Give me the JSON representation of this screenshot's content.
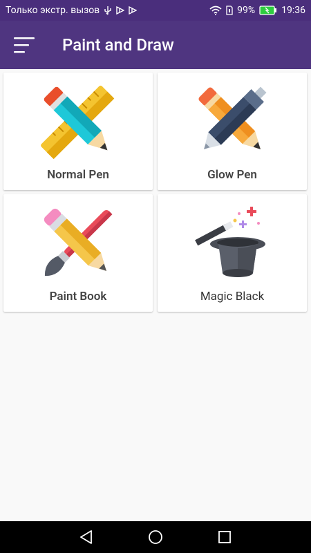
{
  "status_bar": {
    "carrier_text": "Только экстр. вызов",
    "battery_percent": "99%",
    "time": "19:36",
    "icons": [
      "usb-icon",
      "notification-icon",
      "notification-icon",
      "wifi-icon",
      "sim-icon",
      "battery-icon"
    ]
  },
  "app_bar": {
    "title": "Paint and Draw",
    "menu_icon": "menu-icon"
  },
  "cards": [
    {
      "label": "Normal Pen",
      "icon": "pencil-ruler-icon"
    },
    {
      "label": "Glow Pen",
      "icon": "pen-pencil-icon"
    },
    {
      "label": "Paint Book",
      "icon": "pencil-brush-icon"
    },
    {
      "label": "Magic Black",
      "icon": "magic-hat-icon"
    }
  ],
  "colors": {
    "status_bar": "#4a2e7c",
    "app_bar": "#4f3580",
    "background": "#f9f9f9",
    "card": "#ffffff"
  }
}
